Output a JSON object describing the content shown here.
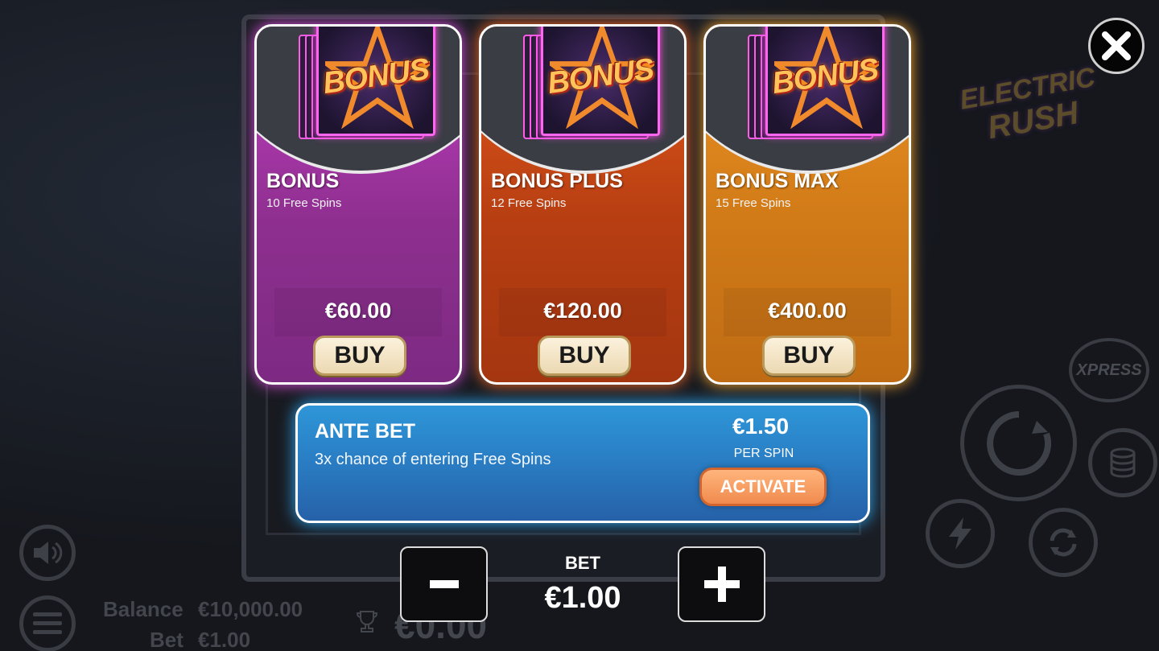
{
  "background": {
    "logo_line1": "ELECTRIC",
    "logo_line2": "RUSH",
    "xpress_label": "XPRESS",
    "balance_label": "Balance",
    "balance_value": "€10,000.00",
    "bet_label": "Bet",
    "bet_value": "€1.00",
    "win_value": "€0.00"
  },
  "cards": [
    {
      "title": "BONUS",
      "subtitle": "10 Free Spins",
      "price": "€60.00",
      "button": "BUY",
      "art_text": "BONUS"
    },
    {
      "title": "BONUS PLUS",
      "subtitle": "12 Free Spins",
      "price": "€120.00",
      "button": "BUY",
      "art_text": "BONUS"
    },
    {
      "title": "BONUS MAX",
      "subtitle": "15 Free Spins",
      "price": "€400.00",
      "button": "BUY",
      "art_text": "BONUS"
    }
  ],
  "ante_bet": {
    "title": "ANTE BET",
    "description": "3x chance of entering Free Spins",
    "price": "€1.50",
    "per_spin": "PER SPIN",
    "button": "ACTIVATE"
  },
  "bet_control": {
    "label": "BET",
    "value": "€1.00"
  },
  "colors": {
    "card_bonus": "#8e2f8f",
    "card_bonus_plus": "#b73e12",
    "card_bonus_max": "#d07a18",
    "ante_panel": "#2a7fc5",
    "activate_button": "#f08a4e",
    "buy_button": "#f3e4c4"
  },
  "icons": [
    "close-icon",
    "minus-icon",
    "plus-icon",
    "star-icon",
    "speaker-icon",
    "menu-icon",
    "trophy-icon",
    "spin-icon",
    "lightning-icon",
    "autoplay-icon",
    "coins-icon"
  ]
}
